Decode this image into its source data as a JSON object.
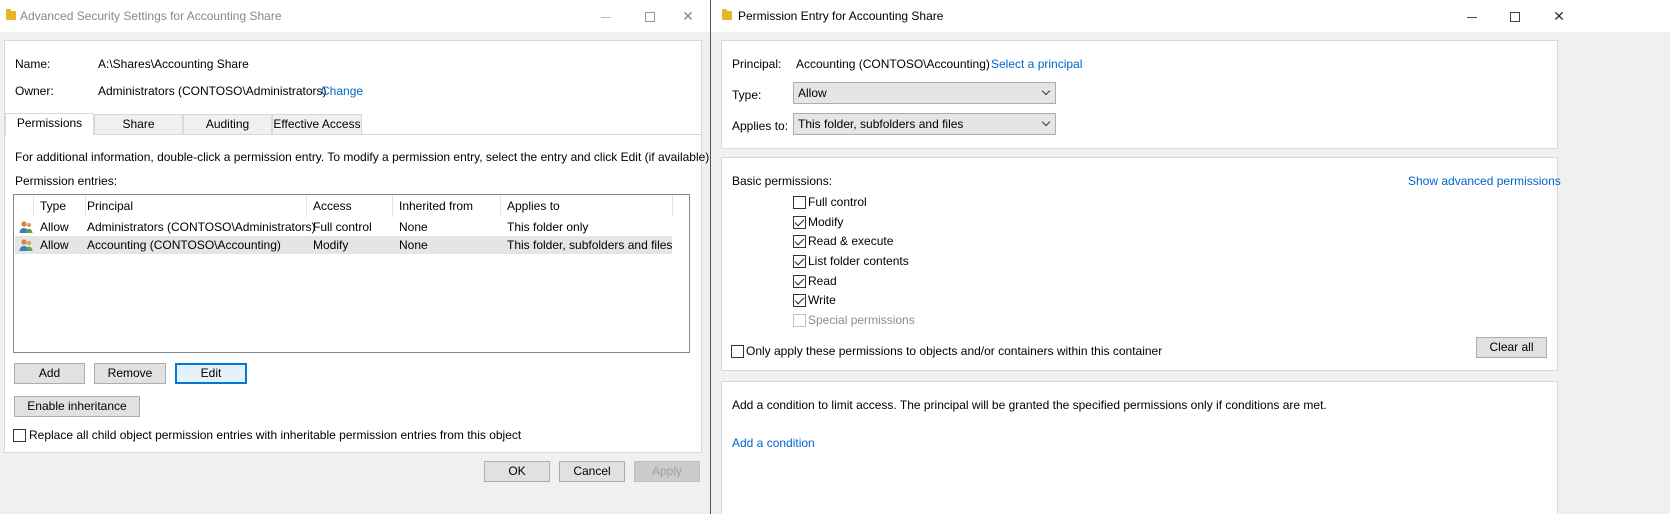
{
  "left_window": {
    "title": "Advanced Security Settings for Accounting Share",
    "name_label": "Name:",
    "name_value": "A:\\Shares\\Accounting Share",
    "owner_label": "Owner:",
    "owner_value": "Administrators (CONTOSO\\Administrators)",
    "change_link": "Change",
    "tabs": [
      {
        "label": "Permissions",
        "active": true
      },
      {
        "label": "Share",
        "active": false
      },
      {
        "label": "Auditing",
        "active": false
      },
      {
        "label": "Effective Access",
        "active": false
      }
    ],
    "info_text": "For additional information, double-click a permission entry. To modify a permission entry, select the entry and click Edit (if available).",
    "entries_label": "Permission entries:",
    "columns": [
      "Type",
      "Principal",
      "Access",
      "Inherited from",
      "Applies to"
    ],
    "rows": [
      {
        "type": "Allow",
        "principal": "Administrators (CONTOSO\\Administrators)",
        "access": "Full control",
        "inherited": "None",
        "applies": "This folder only",
        "icon": "users-icon"
      },
      {
        "type": "Allow",
        "principal": "Accounting (CONTOSO\\Accounting)",
        "access": "Modify",
        "inherited": "None",
        "applies": "This folder, subfolders and files",
        "icon": "users-icon"
      }
    ],
    "add_button": "Add",
    "remove_button": "Remove",
    "edit_button": "Edit",
    "enable_inheritance_button": "Enable inheritance",
    "replace_checkbox_label": "Replace all child object permission entries with inheritable permission entries from this object",
    "ok_button": "OK",
    "cancel_button": "Cancel",
    "apply_button": "Apply"
  },
  "right_window": {
    "title": "Permission Entry for Accounting Share",
    "principal_label": "Principal:",
    "principal_value": "Accounting (CONTOSO\\Accounting)",
    "select_principal_link": "Select a principal",
    "type_label": "Type:",
    "type_value": "Allow",
    "applies_label": "Applies to:",
    "applies_value": "This folder, subfolders and files",
    "basic_permissions_label": "Basic permissions:",
    "show_advanced_link": "Show advanced permissions",
    "permissions": [
      {
        "label": "Full control",
        "checked": false,
        "disabled": false
      },
      {
        "label": "Modify",
        "checked": true,
        "disabled": false
      },
      {
        "label": "Read & execute",
        "checked": true,
        "disabled": false
      },
      {
        "label": "List folder contents",
        "checked": true,
        "disabled": false
      },
      {
        "label": "Read",
        "checked": true,
        "disabled": false
      },
      {
        "label": "Write",
        "checked": true,
        "disabled": false
      },
      {
        "label": "Special permissions",
        "checked": false,
        "disabled": true
      }
    ],
    "only_apply_label": "Only apply these permissions to objects and/or containers within this container",
    "clear_all_button": "Clear all",
    "condition_text": "Add a condition to limit access. The principal will be granted the specified permissions only if conditions are met.",
    "add_condition_link": "Add a condition"
  },
  "colors": {
    "link": "#0066cc",
    "focus_border": "#0078d7",
    "folder_icon": "#e8b42c"
  }
}
